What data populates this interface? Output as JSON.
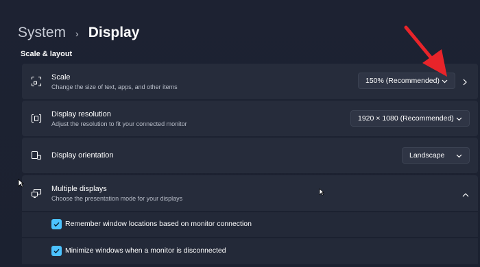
{
  "breadcrumb": {
    "parent": "System",
    "separator": "›",
    "current": "Display"
  },
  "section": {
    "title": "Scale & layout"
  },
  "settings": {
    "scale": {
      "title": "Scale",
      "description": "Change the size of text, apps, and other items",
      "value": "150% (Recommended)",
      "icon": "scale-icon"
    },
    "resolution": {
      "title": "Display resolution",
      "description": "Adjust the resolution to fit your connected monitor",
      "value": "1920 × 1080 (Recommended)",
      "icon": "resolution-icon"
    },
    "orientation": {
      "title": "Display orientation",
      "value": "Landscape",
      "icon": "orientation-icon"
    },
    "multiple_displays": {
      "title": "Multiple displays",
      "description": "Choose the presentation mode for your displays",
      "icon": "multiple-displays-icon",
      "expanded": true,
      "options": [
        {
          "label": "Remember window locations based on monitor connection",
          "checked": true
        },
        {
          "label": "Minimize windows when a monitor is disconnected",
          "checked": true
        }
      ]
    }
  },
  "colors": {
    "accent": "#4cc2ff",
    "annotation_arrow": "#e8242a",
    "card": "#262c3b",
    "background": "#1c2231"
  }
}
